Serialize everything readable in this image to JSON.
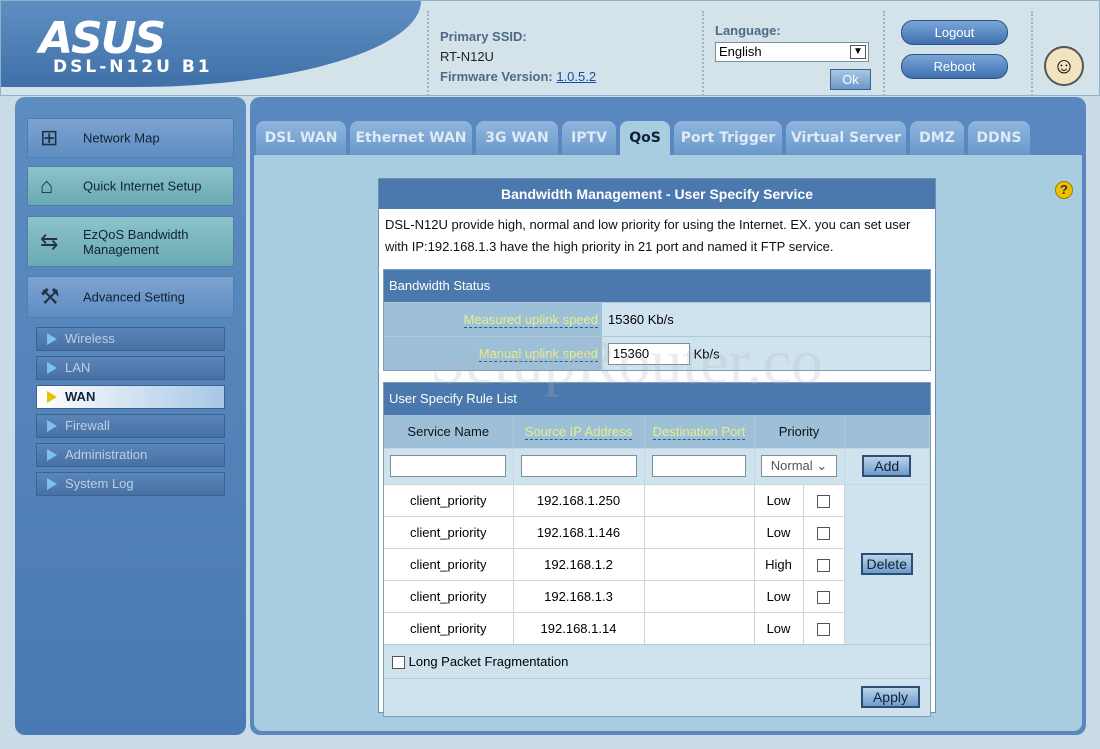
{
  "header": {
    "logo": "ASUS",
    "model": "DSL-N12U B1",
    "ssid_label": "Primary SSID:",
    "ssid": "RT-N12U",
    "fw_label": "Firmware Version:",
    "fw": "1.0.5.2",
    "lang_label": "Language:",
    "lang": "English",
    "ok": "Ok",
    "logout": "Logout",
    "reboot": "Reboot"
  },
  "sidebar": {
    "items": [
      {
        "label": "Network Map"
      },
      {
        "label": "Quick Internet Setup"
      },
      {
        "label": "EzQoS Bandwidth Management"
      },
      {
        "label": "Advanced Setting"
      }
    ],
    "sub": [
      "Wireless",
      "LAN",
      "WAN",
      "Firewall",
      "Administration",
      "System Log"
    ],
    "active_sub": "WAN"
  },
  "tabs": [
    "DSL WAN",
    "Ethernet WAN",
    "3G WAN",
    "IPTV",
    "QoS",
    "Port Trigger",
    "Virtual Server",
    "DMZ",
    "DDNS"
  ],
  "active_tab": "QoS",
  "panel": {
    "title": "Bandwidth Management - User Specify Service",
    "desc": "DSL-N12U provide high, normal and low priority for using the Internet. EX. you can set user with IP:192.168.1.3 have the high priority in 21 port and named it FTP service.",
    "status_title": "Bandwidth Status",
    "measured_label": "Measured uplink speed",
    "measured": "15360 Kb/s",
    "manual_label": "Manual uplink speed",
    "manual": "15360",
    "unit": "Kb/s",
    "rules_title": "User Specify Rule List",
    "cols": [
      "Service Name",
      "Source IP Address",
      "Destination Port",
      "Priority"
    ],
    "priority_default": "Normal",
    "add": "Add",
    "delete": "Delete",
    "rules": [
      {
        "name": "client_priority",
        "ip": "192.168.1.250",
        "port": "",
        "priority": "Low"
      },
      {
        "name": "client_priority",
        "ip": "192.168.1.146",
        "port": "",
        "priority": "Low"
      },
      {
        "name": "client_priority",
        "ip": "192.168.1.2",
        "port": "",
        "priority": "High"
      },
      {
        "name": "client_priority",
        "ip": "192.168.1.3",
        "port": "",
        "priority": "Low"
      },
      {
        "name": "client_priority",
        "ip": "192.168.1.14",
        "port": "",
        "priority": "Low"
      }
    ],
    "long_packet": "Long Packet Fragmentation",
    "apply": "Apply"
  },
  "watermark": "SetupRouter.com"
}
